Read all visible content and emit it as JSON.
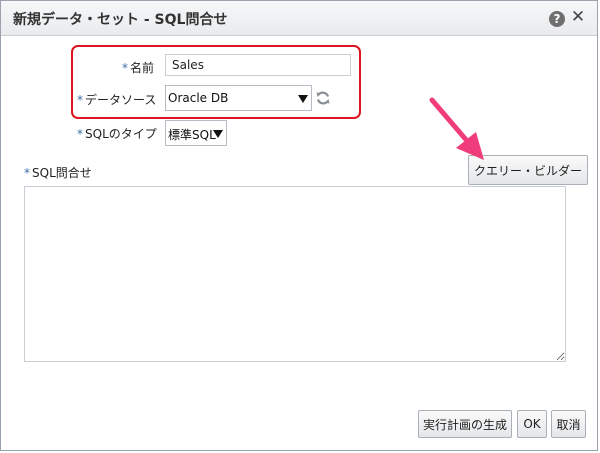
{
  "dialog": {
    "title": "新規データ・セット - SQL問合せ",
    "help_glyph": "?",
    "close_glyph": "✕"
  },
  "form": {
    "required_mark": "*",
    "name_label": "名前",
    "name_value": "Sales",
    "datasource_label": "データソース",
    "datasource_value": "Oracle DB",
    "sqltype_label": "SQLのタイプ",
    "sqltype_value": "標準SQL",
    "sql_query_label": "SQL問合せ",
    "sql_query_value": ""
  },
  "buttons": {
    "query_builder": "クエリー・ビルダー",
    "explain_plan": "実行計画の生成",
    "ok": "OK",
    "cancel": "取消"
  },
  "colors": {
    "highlight_box": "#e0141e",
    "annotation_arrow": "#f03c7a",
    "required_mark": "#3b6ea5"
  },
  "icons": {
    "help": "help-icon",
    "close": "close-icon",
    "refresh": "refresh-icon"
  }
}
